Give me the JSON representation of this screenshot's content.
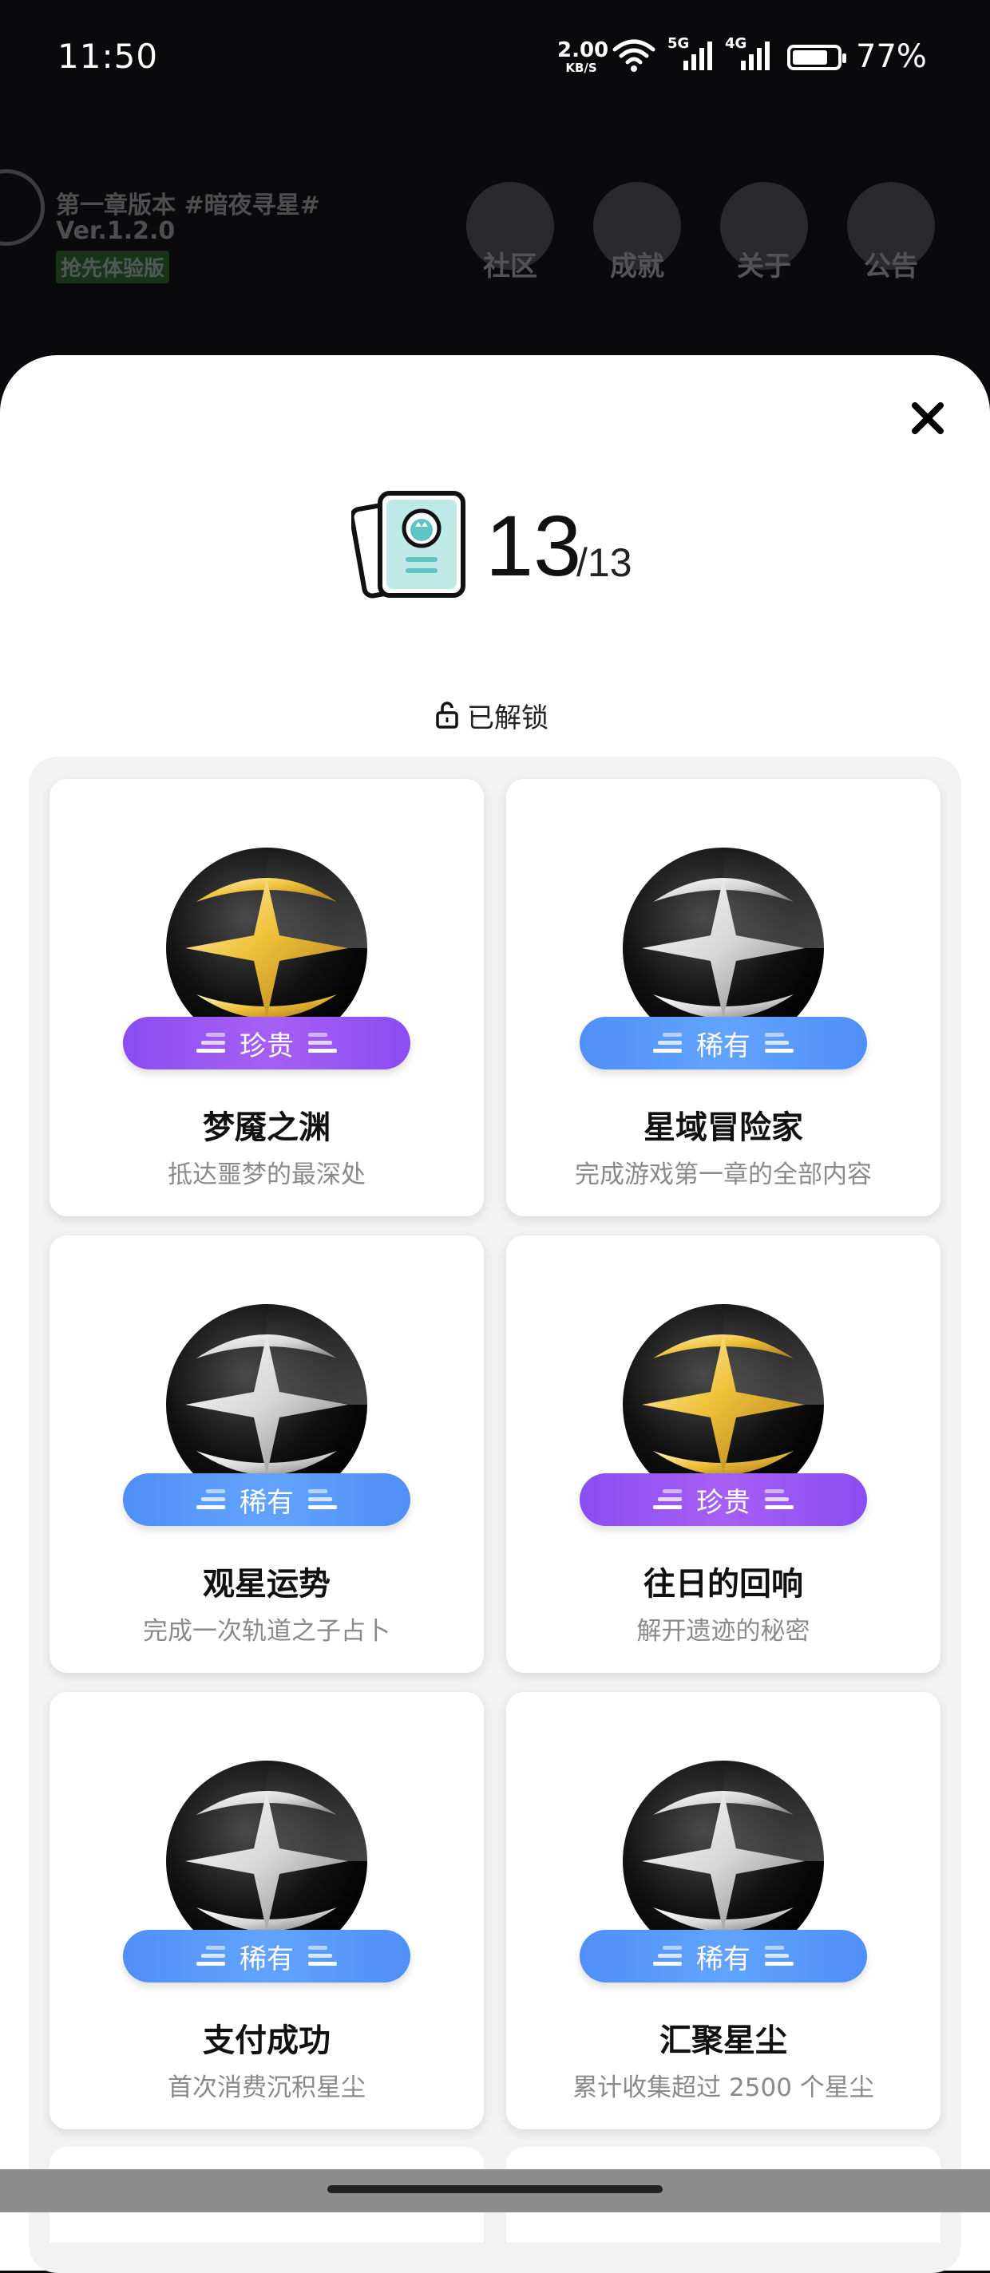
{
  "status_bar": {
    "time": "11:50",
    "net_speed_value": "2.00",
    "net_speed_unit": "KB/S",
    "signal_label_1": "5G",
    "signal_label_2": "4G",
    "battery": "77%"
  },
  "background_app": {
    "chapter_title": "第一章版本 #暗夜寻星#",
    "version": "Ver.1.2.0",
    "badge": "抢先体验版",
    "nav_items": [
      {
        "label": "社区",
        "icon": "community-icon"
      },
      {
        "label": "成就",
        "icon": "achievement-icon"
      },
      {
        "label": "关于",
        "icon": "info-icon"
      },
      {
        "label": "公告",
        "icon": "announcement-icon"
      }
    ]
  },
  "sheet": {
    "close_icon": "close-icon",
    "unlocked_count": "13",
    "total_count": "/13",
    "section_label": "已解锁",
    "colors": {
      "precious": "#9654f3",
      "rare": "#569af9"
    }
  },
  "achievements": [
    {
      "title": "梦魇之渊",
      "description": "抵达噩梦的最深处",
      "rarity": "珍贵",
      "rarity_type": "precious",
      "medal": "gold"
    },
    {
      "title": "星域冒险家",
      "description": "完成游戏第一章的全部内容",
      "rarity": "稀有",
      "rarity_type": "rare",
      "medal": "silver"
    },
    {
      "title": "观星运势",
      "description": "完成一次轨道之子占卜",
      "rarity": "稀有",
      "rarity_type": "rare",
      "medal": "silver"
    },
    {
      "title": "往日的回响",
      "description": "解开遗迹的秘密",
      "rarity": "珍贵",
      "rarity_type": "precious",
      "medal": "gold"
    },
    {
      "title": "支付成功",
      "description": "首次消费沉积星尘",
      "rarity": "稀有",
      "rarity_type": "rare",
      "medal": "silver"
    },
    {
      "title": "汇聚星尘",
      "description": "累计收集超过 2500 个星尘",
      "rarity": "稀有",
      "rarity_type": "rare",
      "medal": "silver"
    }
  ]
}
